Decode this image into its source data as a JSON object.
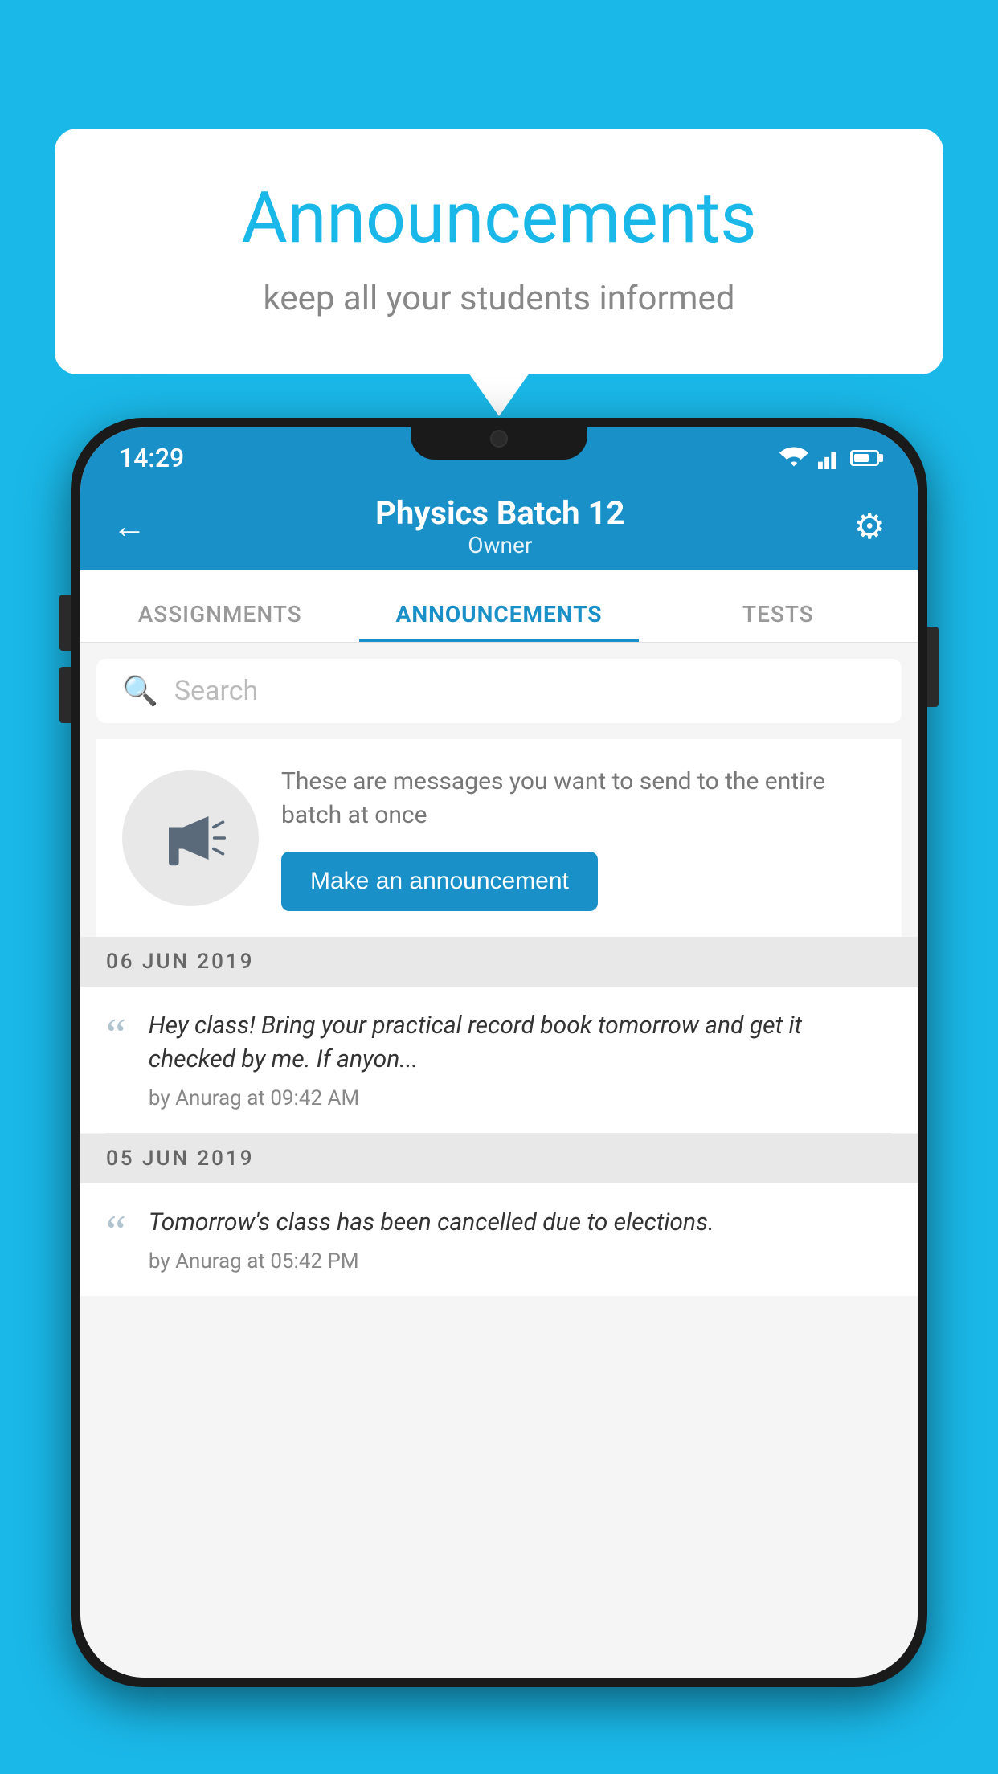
{
  "background_color": "#1ab8e8",
  "speech_bubble": {
    "title": "Announcements",
    "subtitle": "keep all your students informed"
  },
  "status_bar": {
    "time": "14:29",
    "wifi_icon": "wifi",
    "signal_icon": "signal",
    "battery_icon": "battery"
  },
  "header": {
    "back_label": "←",
    "title": "Physics Batch 12",
    "subtitle": "Owner",
    "settings_icon": "gear"
  },
  "tabs": [
    {
      "label": "ASSIGNMENTS",
      "active": false
    },
    {
      "label": "ANNOUNCEMENTS",
      "active": true
    },
    {
      "label": "TESTS",
      "active": false
    }
  ],
  "search": {
    "placeholder": "Search"
  },
  "promo": {
    "icon": "📣",
    "description": "These are messages you want to send to the entire batch at once",
    "button_label": "Make an announcement"
  },
  "announcements": [
    {
      "date": "06  JUN  2019",
      "text": "Hey class! Bring your practical record book tomorrow and get it checked by me. If anyon...",
      "author": "by Anurag at 09:42 AM"
    },
    {
      "date": "05  JUN  2019",
      "text": "Tomorrow's class has been cancelled due to elections.",
      "author": "by Anurag at 05:42 PM"
    }
  ]
}
